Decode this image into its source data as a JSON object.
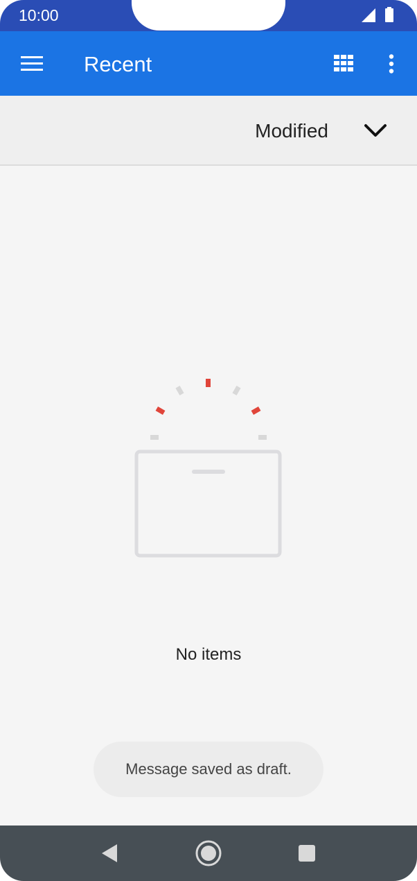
{
  "status_bar": {
    "time": "10:00",
    "icons": [
      "signal-icon",
      "battery-icon"
    ]
  },
  "app_bar": {
    "title": "Recent",
    "icons": [
      "menu-icon",
      "grid-view-icon",
      "more-options-icon"
    ]
  },
  "sort_bar": {
    "label": "Modified",
    "icon": "chevron-down-icon"
  },
  "empty_state": {
    "icon": "empty-folder-icon",
    "message": "No items"
  },
  "toast": {
    "message": "Message saved as draft."
  },
  "nav_bar": {
    "icons": [
      "back-icon",
      "home-icon",
      "recents-icon"
    ]
  },
  "colors": {
    "status_bar": "#2a4db5",
    "app_bar": "#1b74e4",
    "sort_bar": "#efefef",
    "background": "#f5f5f5",
    "nav_bar": "#474f55",
    "accent_red": "#e0453a",
    "tick_gray": "#d8d8d8"
  }
}
